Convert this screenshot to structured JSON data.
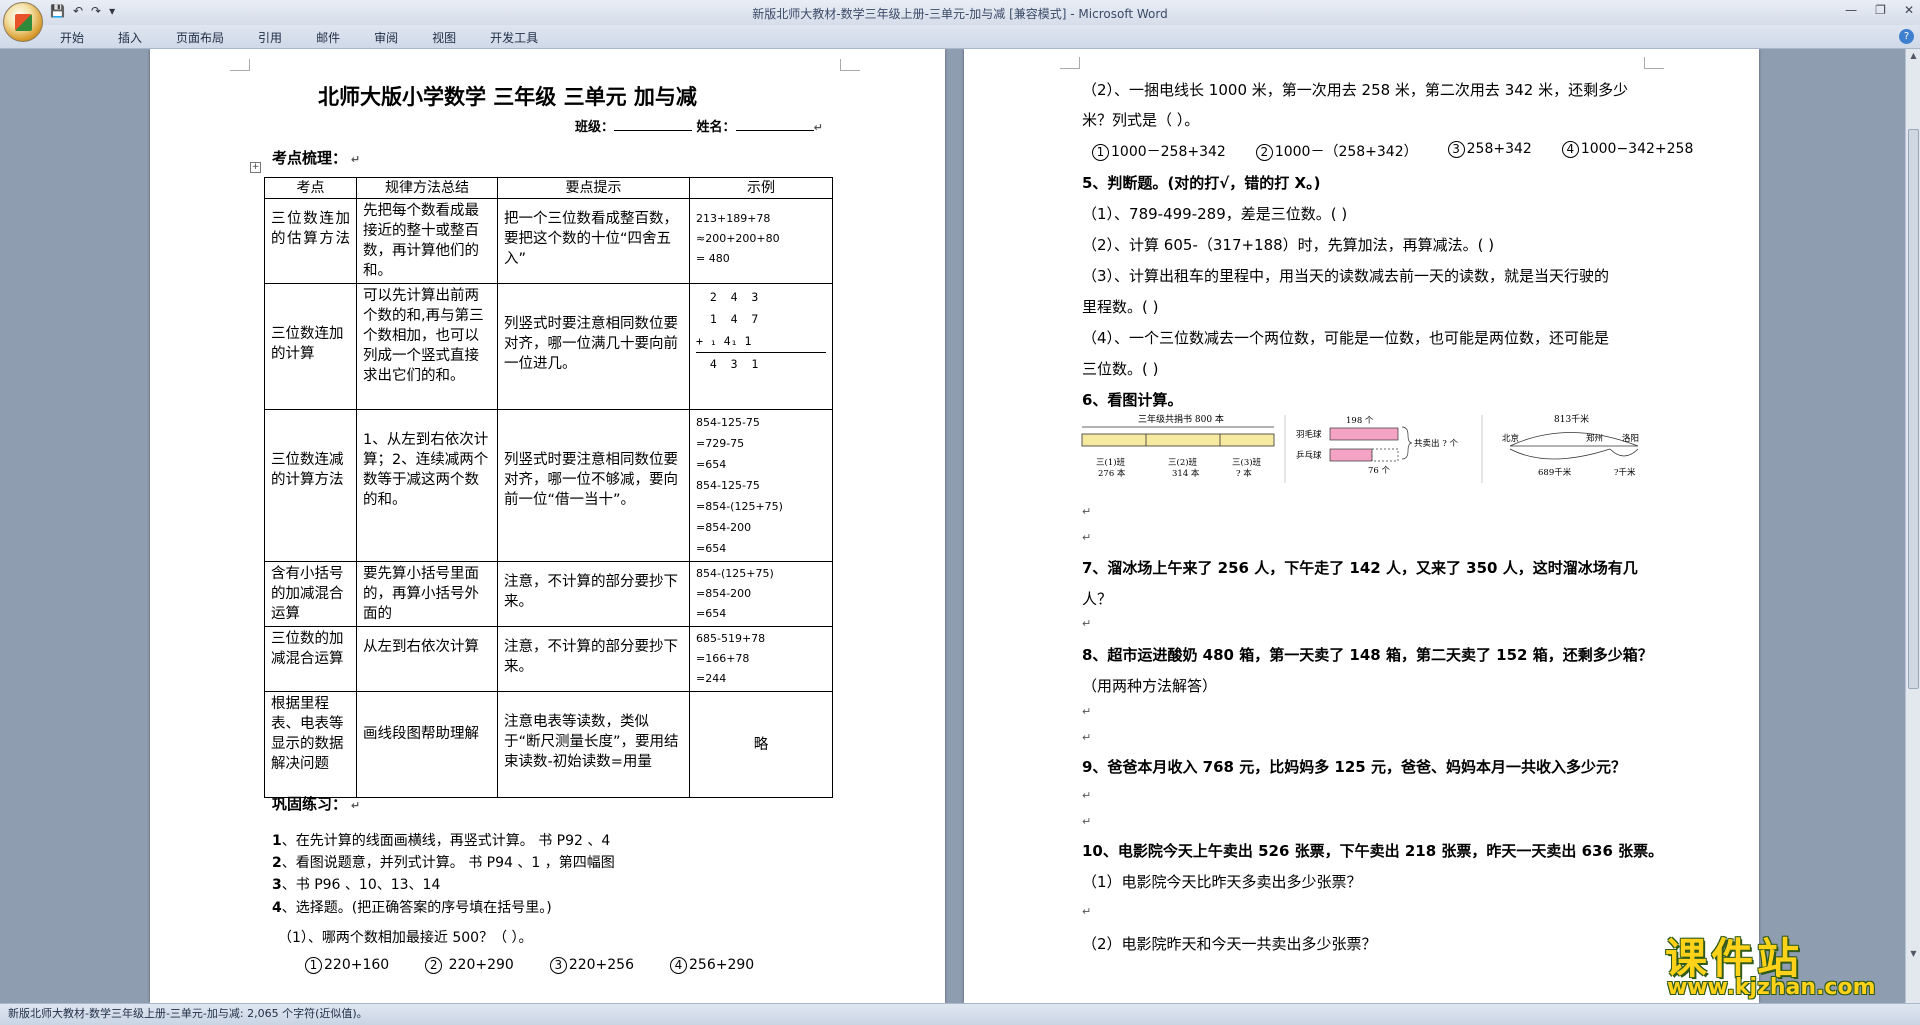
{
  "window": {
    "title": "新版北师大教材-数学三年级上册-三单元-加与减 [兼容模式] - Microsoft Word",
    "qat": [
      "💾",
      "↶",
      "↷",
      "▾"
    ],
    "controls": [
      "—",
      "❐",
      "✕"
    ]
  },
  "ribbon": {
    "tabs": [
      "开始",
      "插入",
      "页面布局",
      "引用",
      "邮件",
      "审阅",
      "视图",
      "开发工具"
    ],
    "help": "?"
  },
  "status": "新版北师大教材-数学三年级上册-三单元-加与减: 2,065 个字符(近似值)。",
  "page1": {
    "title": "北师大版小学数学 三年级 三单元 加与减",
    "class_label": "班级：",
    "name_label": "姓名：",
    "section1": "考点梳理：",
    "table_anchor": "+",
    "table": {
      "headers": [
        "考点",
        "规律方法总结",
        "要点提示",
        "示例"
      ],
      "rows": [
        {
          "topic": "三位数连加的估算方法",
          "method": "先把每个数看成最接近的整十或整百数，再计算他们的和。",
          "tip": "把一个三位数看成整百数，要把这个数的十位“四舍五入”",
          "example": [
            "213+189+78",
            "≈200+200+80",
            "= 480"
          ]
        },
        {
          "topic": "三位数连加的计算",
          "method": "可以先计算出前两个数的和,再与第三个数相加，也可以列成一个竖式直接求出它们的和。",
          "tip": "列竖式时要注意相同数位要对齐，哪一位满几十要向前一位进几。",
          "example": [
            "  2  4  3",
            "  1  4  7",
            "+ ₁ 4₁ 1",
            "  4  3  1"
          ]
        },
        {
          "topic": "三位数连减的计算方法",
          "method": "1、从左到右依次计算；2、连续减两个数等于减这两个数的和。",
          "tip": "列竖式时要注意相同数位要对齐，哪一位不够减，要向前一位“借一当十”。",
          "example": [
            "854-125-75",
            "=729-75",
            "=654",
            "854-125-75",
            "=854-(125+75)",
            "=854-200",
            "=654"
          ]
        },
        {
          "topic": "含有小括号的加减混合运算",
          "method": "要先算小括号里面的，再算小括号外面的",
          "tip": "注意，不计算的部分要抄下来。",
          "example": [
            "854-(125+75)",
            "=854-200",
            "=654"
          ]
        },
        {
          "topic": "三位数的加减混合运算",
          "method": "从左到右依次计算",
          "tip": "注意，不计算的部分要抄下来。",
          "example": [
            "685-519+78",
            "=166+78",
            "=244"
          ]
        },
        {
          "topic": "根据里程表、电表等显示的数据解决问题",
          "method": "画线段图帮助理解",
          "tip": "注意电表等读数，类似于“断尺测量长度”，要用结束读数-初始读数=用量",
          "example": [
            "略"
          ]
        }
      ]
    },
    "section2": "巩固练习：",
    "exercises": [
      {
        "num": "1",
        "text": "、在先计算的线面画横线，再竖式计算。    书 P92 、4"
      },
      {
        "num": "2",
        "text": "、看图说题意，并列式计算。  书 P94 、1 ，第四幅图"
      },
      {
        "num": "3",
        "text": "、书 P96 、10、13、14"
      },
      {
        "num": "4",
        "text": "、选择题。(把正确答案的序号填在括号里。)"
      }
    ],
    "q4_1": "（1）、哪两个数相加最接近 500？（        ）。",
    "q4_1_options": [
      {
        "n": "1",
        "v": "220+160"
      },
      {
        "n": "2",
        "v": " 220+290"
      },
      {
        "n": "3",
        "v": "220+256"
      },
      {
        "n": "4",
        "v": "256+290"
      }
    ]
  },
  "page2": {
    "q4_2": "（2）、一捆电线长 1000 米，第一次用去 258 米，第二次用去 342 米，还剩多少",
    "q4_2b": "米？列式是（        ）。",
    "q4_2_options": [
      {
        "n": "1",
        "v": "1000－258+342"
      },
      {
        "n": "2",
        "v": "1000－（258+342）"
      },
      {
        "n": "3",
        "v": "258+342"
      },
      {
        "n": "4",
        "v": "1000−342+258"
      }
    ],
    "q5": "5、判断题。(对的打√，错的打 X。)",
    "q5_items": [
      "（1）、789-499-289，差是三位数。(      )",
      "（2）、计算 605-（317+188）时，先算加法，再算减法。(      )",
      "（3）、计算出租车的里程中，用当天的读数减去前一天的读数，就是当天行驶的",
      "里程数。(      )",
      "（4）、一个三位数减去一个两位数，可能是一位数，也可能是两位数，还可能是",
      "三位数。(      )"
    ],
    "q6": "6、看图计算。",
    "fig": {
      "f1_title": "三年级共捐书 800 本",
      "f1_labels": [
        "三(1)班",
        "三(2)班",
        "三(3)班"
      ],
      "f1_values": [
        "276 本",
        "314 本",
        "? 本"
      ],
      "f2_top": "198 个",
      "f2_rows": [
        "羽毛球",
        "乒乓球"
      ],
      "f2_brace": "共卖出 ? 个",
      "f2_bottom": "76 个",
      "f3_top": "813千米",
      "f3_cities": [
        "北京",
        "郑州",
        "洛阳"
      ],
      "f3_bottom": [
        "689千米",
        "?千米"
      ]
    },
    "q7a": "7、溜冰场上午来了 256 人，下午走了 142 人，又来了 350 人，这时溜冰场有几",
    "q7b": "人？",
    "q8a": "8、超市运进酸奶 480 箱，第一天卖了 148 箱，第二天卖了 152 箱，还剩多少箱？",
    "q8b": "（用两种方法解答）",
    "q9": "9、爸爸本月收入 768 元，比妈妈多 125 元，爸爸、妈妈本月一共收入多少元？",
    "q10": "10、电影院今天上午卖出 526 张票，下午卖出 218 张票，昨天一天卖出 636 张票。",
    "q10_1": "（1）电影院今天比昨天多卖出多少张票？",
    "q10_2": "（2）电影院昨天和今天一共卖出多少张票？"
  },
  "watermark": {
    "main": "课件站",
    "url": "www.kjzhan.com"
  }
}
